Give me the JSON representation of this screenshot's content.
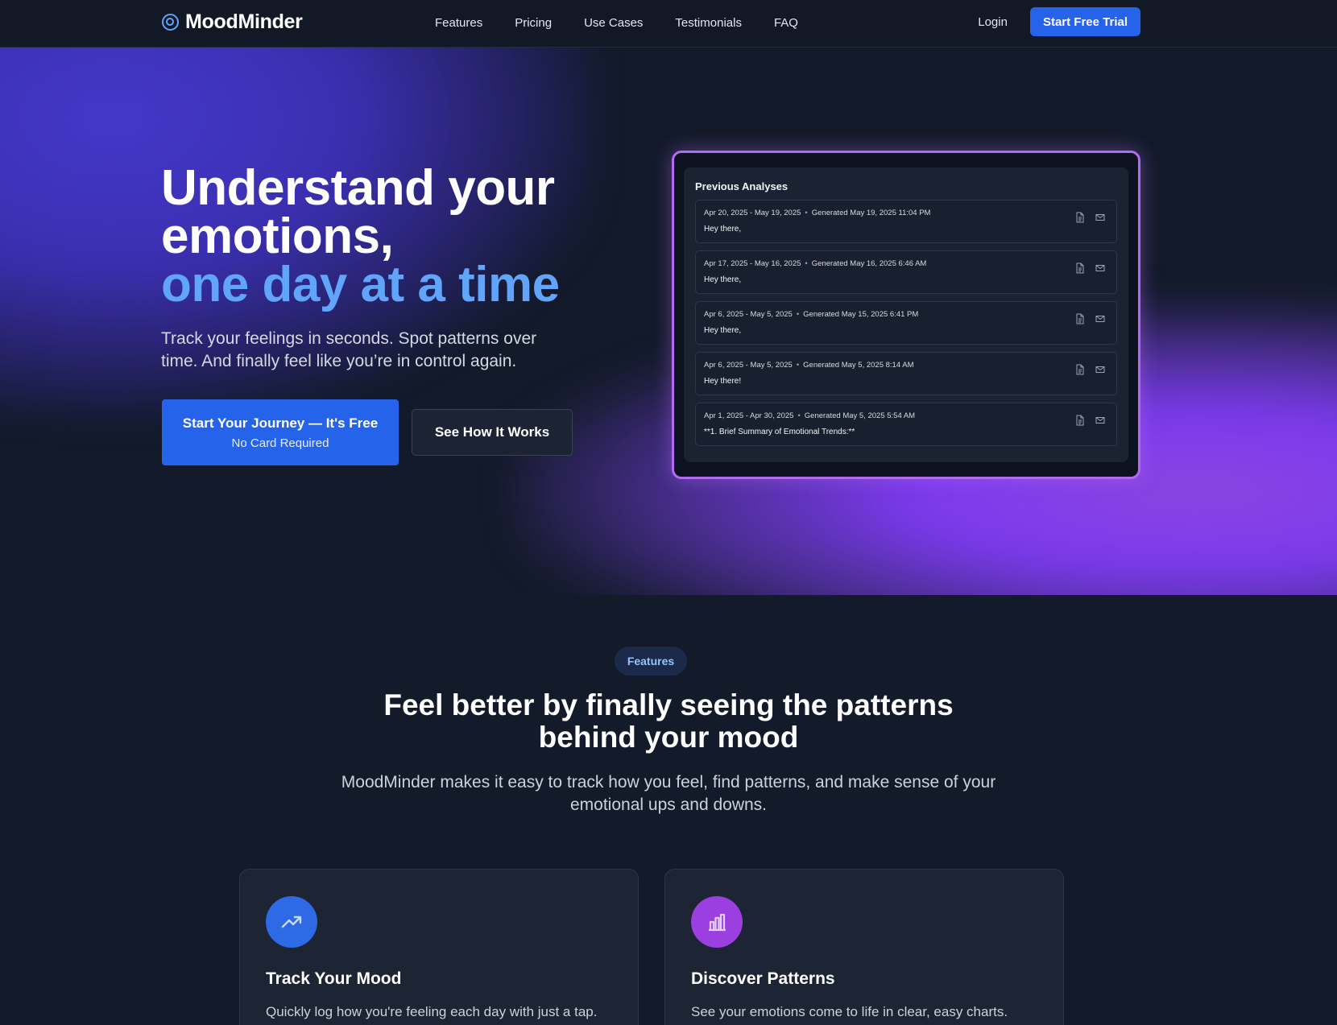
{
  "nav": {
    "brand": "MoodMinder",
    "links": [
      "Features",
      "Pricing",
      "Use Cases",
      "Testimonials",
      "FAQ"
    ],
    "login": "Login",
    "cta": "Start Free Trial"
  },
  "hero": {
    "title_line1": "Understand your",
    "title_line2": "emotions,",
    "title_accent": "one day at a time",
    "subtitle": "Track your feelings in seconds. Spot patterns over time. And finally feel like you’re in control again.",
    "cta_primary_line1": "Start Your Journey — It's Free",
    "cta_primary_line2": "No Card Required",
    "cta_secondary": "See How It Works"
  },
  "preview": {
    "title": "Previous Analyses",
    "rows": [
      {
        "range": "Apr 20, 2025 - May 19, 2025",
        "generated": "Generated May 19, 2025 11:04 PM",
        "text": "Hey there,"
      },
      {
        "range": "Apr 17, 2025 - May 16, 2025",
        "generated": "Generated May 16, 2025 6:46 AM",
        "text": "Hey there,"
      },
      {
        "range": "Apr 6, 2025 - May 5, 2025",
        "generated": "Generated May 15, 2025 6:41 PM",
        "text": "Hey there,"
      },
      {
        "range": "Apr 6, 2025 - May 5, 2025",
        "generated": "Generated May 5, 2025 8:14 AM",
        "text": "Hey there!"
      },
      {
        "range": "Apr 1, 2025 - Apr 30, 2025",
        "generated": "Generated May 5, 2025 5:54 AM",
        "text": "**1. Brief Summary of Emotional Trends:**"
      }
    ]
  },
  "features": {
    "pill": "Features",
    "title_line1": "Feel better by finally seeing the patterns",
    "title_line2": "behind your mood",
    "subtitle": "MoodMinder makes it easy to track how you feel, find patterns, and make sense of your emotional ups and downs.",
    "cards": [
      {
        "title": "Track Your Mood",
        "text": "Quickly log how you're feeling each day with just a tap.",
        "icon": "trending-up-icon"
      },
      {
        "title": "Discover Patterns",
        "text": "See your emotions come to life in clear, easy charts.",
        "icon": "bar-chart-icon"
      }
    ]
  }
}
